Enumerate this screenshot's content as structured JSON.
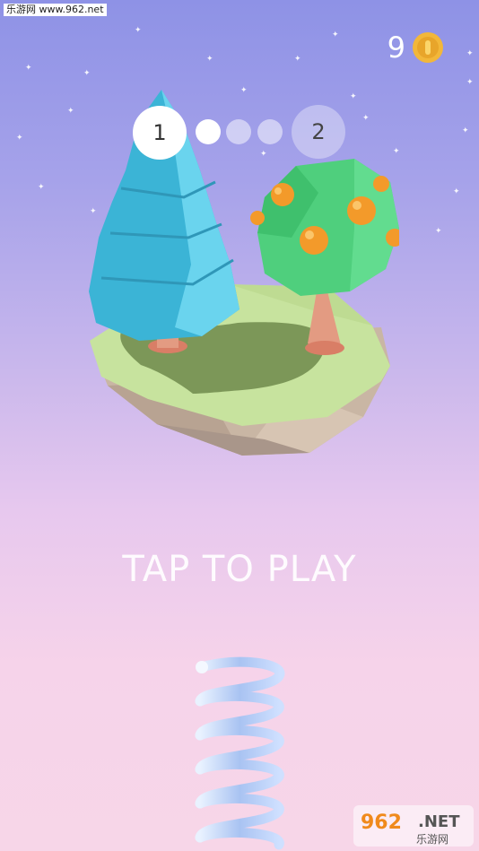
{
  "watermark": {
    "top_left": "乐游网 www.962.net",
    "bottom_right_logo": "962.NET 乐游网"
  },
  "coins": {
    "count": "9",
    "icon": "coin-icon"
  },
  "level": {
    "current": "1",
    "next": "2",
    "progress_dots_total": 3,
    "progress_dots_filled": 1
  },
  "prompt": "TAP TO PLAY",
  "colors": {
    "sky_top": "#8e92e6",
    "sky_bottom": "#f7d6e8",
    "coin": "#f2b73a",
    "pine": "#3bb4d6",
    "foliage": "#4fcf7d",
    "orange": "#f39a2a"
  }
}
